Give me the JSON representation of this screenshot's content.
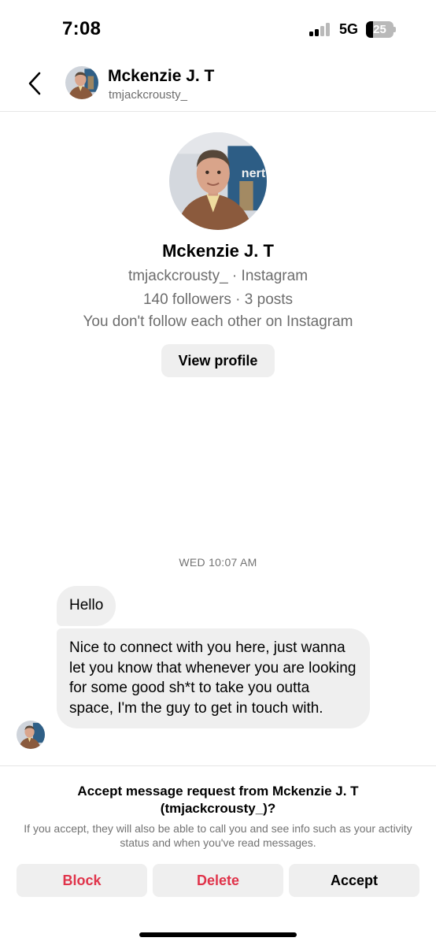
{
  "status_bar": {
    "time": "7:08",
    "network": "5G",
    "battery": "25",
    "icons": [
      "signal-icon",
      "battery-icon"
    ]
  },
  "header": {
    "back_icon": "chevron-left-icon",
    "name": "Mckenzie J. T",
    "handle": "tmjackcrousty_"
  },
  "profile": {
    "name": "Mckenzie J. T",
    "source_line": "tmjackcrousty_ · Instagram",
    "stats_line": "140 followers · 3 posts",
    "relation_line": "You don't follow each other on Instagram",
    "view_profile_label": "View profile"
  },
  "conversation": {
    "timestamp": "WED 10:07 AM",
    "messages": [
      "Hello",
      "Nice to connect with you here, just wanna let you know that whenever you are looking for some good sh*t to take you outta space, I'm the guy to get in touch with."
    ]
  },
  "request": {
    "title": "Accept message request from Mckenzie J. T (tmjackcrousty_)?",
    "note": "If you accept, they will also be able to call you and see info such as your activity status and when you've read messages.",
    "block_label": "Block",
    "delete_label": "Delete",
    "accept_label": "Accept"
  },
  "colors": {
    "danger": "#e0334a",
    "bubble": "#efefef",
    "secondary_text": "#6d6d6d"
  }
}
